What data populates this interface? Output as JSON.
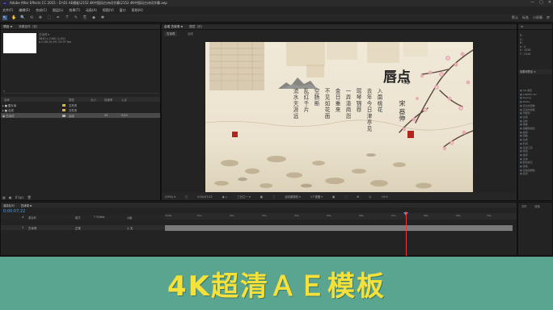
{
  "window": {
    "title": "Adobe After Effects CC 2015 - D:\\01 AE模板\\2152 4K中国风古诗词字幕\\2152 4K中国风古诗词字幕.aep",
    "app_badge": "Ae",
    "controls": [
      "—",
      "▢",
      "✕"
    ]
  },
  "menu": [
    "文件(F)",
    "编辑(E)",
    "合成(C)",
    "图层(L)",
    "效果(T)",
    "动画(A)",
    "视图(V)",
    "窗口",
    "帮助(H)"
  ],
  "toolbar": {
    "tools": [
      "↖",
      "✋",
      "🔍",
      "⟲",
      "✥",
      "⬚",
      "✒",
      "T",
      "✎",
      "⎘",
      "◆",
      "✱"
    ],
    "workspace": [
      "默认",
      "标准",
      "小屏幕",
      "库"
    ]
  },
  "project": {
    "tabs": [
      "项目 ≡",
      "效果控件（无）"
    ],
    "info_lines": [
      "古诗词 ▾",
      "3840 x 2160 (1.00)",
      "Δ 0;00;10;29, 29.97 fps",
      ""
    ],
    "search_placeholder": "⌕",
    "columns": [
      "名称",
      "类型",
      "大小",
      "帧速率",
      "入点"
    ],
    "items": [
      {
        "name": "▸ ■ 图片库",
        "type": "文件夹",
        "size": "",
        "fps": "",
        "in": ""
      },
      {
        "name": "▸ ■ 合成",
        "type": "文件夹",
        "size": "",
        "fps": "",
        "in": ""
      },
      {
        "name": "  ▣ 古诗词",
        "type": "合成",
        "size": "",
        "fps": "29",
        "in": "0;00"
      }
    ],
    "bottom_icons": [
      "▦",
      "▣",
      "8 bpc",
      "🗑"
    ]
  },
  "composition": {
    "tabs": [
      "合成 古诗词 ≡",
      "图层（无）"
    ],
    "breadcrumb": "古诗词",
    "sub_tab": "合成",
    "viewer": [
      "(25%) ▾",
      "▢",
      "0;00;07;22",
      "◉ ◇",
      "三分之一 ▾",
      "▣",
      "⬚",
      "活动摄像机 ▾",
      "1个视图 ▾",
      "▣",
      "⬚",
      "⊞",
      "◎",
      "+0.0"
    ]
  },
  "poster": {
    "title_main": "唇点",
    "title_second": "绛",
    "author": "宋 蔡伸",
    "poem_columns": [
      "入面桃花",
      "去年今日津亭见",
      "瑶琴锦荐",
      "一弄清商怨",
      "金日重来",
      "不见如花面",
      "空肠断",
      "乱红千片",
      "流水天涯远"
    ]
  },
  "right": {
    "info_lines": [
      "R :",
      "G :",
      "B :",
      "A : 0",
      "X : 1256",
      "Y : 2144"
    ],
    "effects_title": "效果和预设 ≡",
    "effects": [
      "3D 通道",
      "CINEMA 4D",
      "Keying",
      "Matte",
      "表达式控制",
      "沉浸式视频",
      "风格化",
      "过渡",
      "过时",
      "抠像",
      "模糊和锐化",
      "模拟",
      "扭曲",
      "生成",
      "时间",
      "实用工具",
      "通道",
      "透视",
      "文本",
      "颜色校正",
      "音频",
      "杂色和颗粒",
      "遮罩"
    ],
    "bottom": [
      "字符",
      "段落"
    ]
  },
  "timeline": {
    "tabs": [
      "渲染队列",
      "古诗词 ≡"
    ],
    "timecode": "0;00;07;22",
    "ruler": [
      "0;00s",
      "01s",
      "02s",
      "03s",
      "04s",
      "05s",
      "06s",
      "07s",
      "08s",
      "09s",
      "10s"
    ],
    "layer_cols": [
      "#",
      "源名称",
      "模式",
      "T TrkMat",
      "父级"
    ],
    "layer": {
      "index": "1",
      "name": "古诗词",
      "mode": "正常",
      "parent": "◎ 无"
    }
  },
  "banner": {
    "text": "4K超清ＡＥ模板"
  }
}
